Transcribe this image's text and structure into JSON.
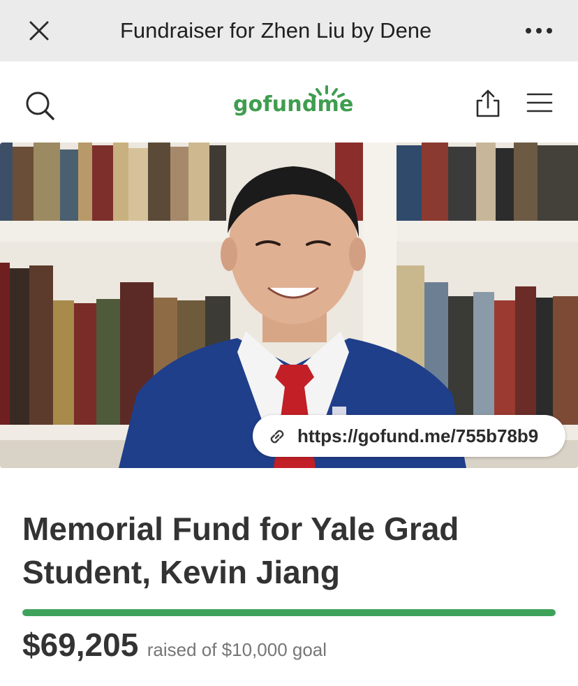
{
  "browser": {
    "title": "Fundraiser for Zhen Liu by Dene"
  },
  "header": {
    "logo": "gofundme"
  },
  "hero": {
    "short_link": "https://gofund.me/755b78b9"
  },
  "campaign": {
    "title": "Memorial Fund for Yale Grad Student, Kevin Jiang",
    "raised_amount": "$69,205",
    "goal_text": "raised of $10,000 goal",
    "progress_fraction": 1.0
  },
  "colors": {
    "brand_green": "#3ea35a",
    "topbar_bg": "#ebebeb"
  }
}
